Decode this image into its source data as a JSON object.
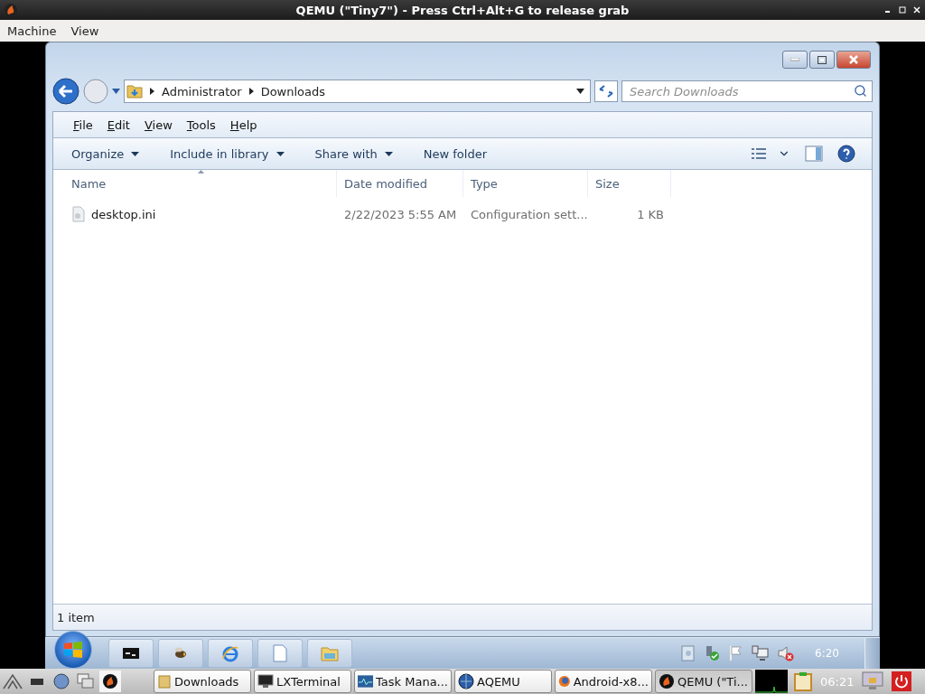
{
  "host_window": {
    "title": "QEMU (\"Tiny7\") - Press Ctrl+Alt+G to release grab"
  },
  "host_menu": [
    "Machine",
    "View"
  ],
  "explorer": {
    "breadcrumb": [
      "Administrator",
      "Downloads"
    ],
    "search": {
      "placeholder": "Search Downloads"
    },
    "menu": [
      "File",
      "Edit",
      "View",
      "Tools",
      "Help"
    ],
    "commands": [
      {
        "label": "Organize",
        "dropdown": true
      },
      {
        "label": "Include in library",
        "dropdown": true
      },
      {
        "label": "Share with",
        "dropdown": true
      },
      {
        "label": "New folder",
        "dropdown": false
      }
    ],
    "columns": [
      "Name",
      "Date modified",
      "Type",
      "Size"
    ],
    "rows": [
      {
        "name": "desktop.ini",
        "date": "2/22/2023 5:55 AM",
        "type": "Configuration sett...",
        "size": "1 KB"
      }
    ],
    "status_bar": "1 item"
  },
  "guest_taskbar": {
    "clock": "6:20"
  },
  "host_panel": {
    "tasks": [
      {
        "label": "Downloads",
        "kind": "folder",
        "selected": false
      },
      {
        "label": "LXTerminal",
        "kind": "terminal",
        "selected": false
      },
      {
        "label": "Task Mana...",
        "kind": "monitor",
        "selected": false
      },
      {
        "label": "AQEMU",
        "kind": "aqemu",
        "selected": false
      },
      {
        "label": "Android-x8...",
        "kind": "firefox",
        "selected": false
      },
      {
        "label": "QEMU (\"Ti...",
        "kind": "qemu",
        "selected": true
      }
    ],
    "clock": "06:21"
  }
}
